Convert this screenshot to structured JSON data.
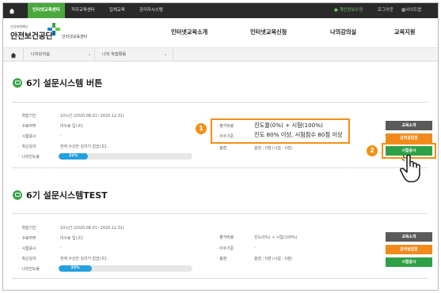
{
  "topbar": {
    "tabs": [
      "인터넷교육센터",
      "직무교육센터",
      "집체교육",
      "관리자시스템"
    ],
    "right": [
      "개인정보수정",
      "로그아웃",
      "사이트맵"
    ]
  },
  "header": {
    "logo_small": "산업재해예방",
    "logo_main": "안전보건공단",
    "logo_sub": "인터넷교육센터",
    "nav": [
      "인터넷교육소개",
      "인터넷교육신청",
      "나의강의실",
      "교육지원"
    ]
  },
  "location": [
    "나의강의실",
    "나의 학습활동"
  ],
  "courses": [
    {
      "title": "6기 설문시스템 버튼",
      "labels": [
        "학습기간",
        "수료여부",
        "시험응시",
        "최근강의",
        "나의진도율"
      ],
      "period": "10시간 (2020.08.01~2020.12.31)",
      "completion": "미수료 입니다.",
      "exam": "-",
      "recent": "현재 수강한 강의가 없습니다.",
      "progress_label": "22%",
      "progress": 22,
      "right_labels": [
        "평가비율",
        "이수기준",
        "총점"
      ],
      "eval_ratio": "진도율(0%) + 시험(100%)",
      "criteria": "진도 80% 이상, 시험점수 80점 이상",
      "total": "총점 : 0점 (시험 : 0점)",
      "buttons": [
        "교육소개",
        "강의실입장",
        "시험응시"
      ]
    },
    {
      "title": "6기 설문시스템TEST",
      "labels": [
        "학습기간",
        "수료여부",
        "시험응시",
        "최근강의",
        "나의진도율"
      ],
      "period": "10시간 (2020.08.01~2020.12.31)",
      "completion": "미수료 입니다.",
      "exam": "-",
      "recent": "현재 수강한 강의가 없습니다.",
      "progress_label": "25%",
      "progress": 25,
      "right_labels": [
        "평가비율",
        "이수기준",
        "총점"
      ],
      "eval_ratio": "진도(0%) + 시험(100%)",
      "criteria": "-",
      "total": "총점 : 0점 (시험 : 0점)",
      "buttons": [
        "교육소개",
        "강의실입장",
        "시험응시"
      ]
    }
  ],
  "callouts": [
    "1",
    "2"
  ],
  "colors": {
    "accent_green": "#2fa046",
    "highlight_orange": "#f39016",
    "progress_blue": "#25a1dd",
    "topbar_dark": "#2a2a2a"
  },
  "icons": [
    "home-icon",
    "chat-bubble-icon",
    "hand-pointer-icon",
    "user-icon",
    "grid-icon"
  ]
}
